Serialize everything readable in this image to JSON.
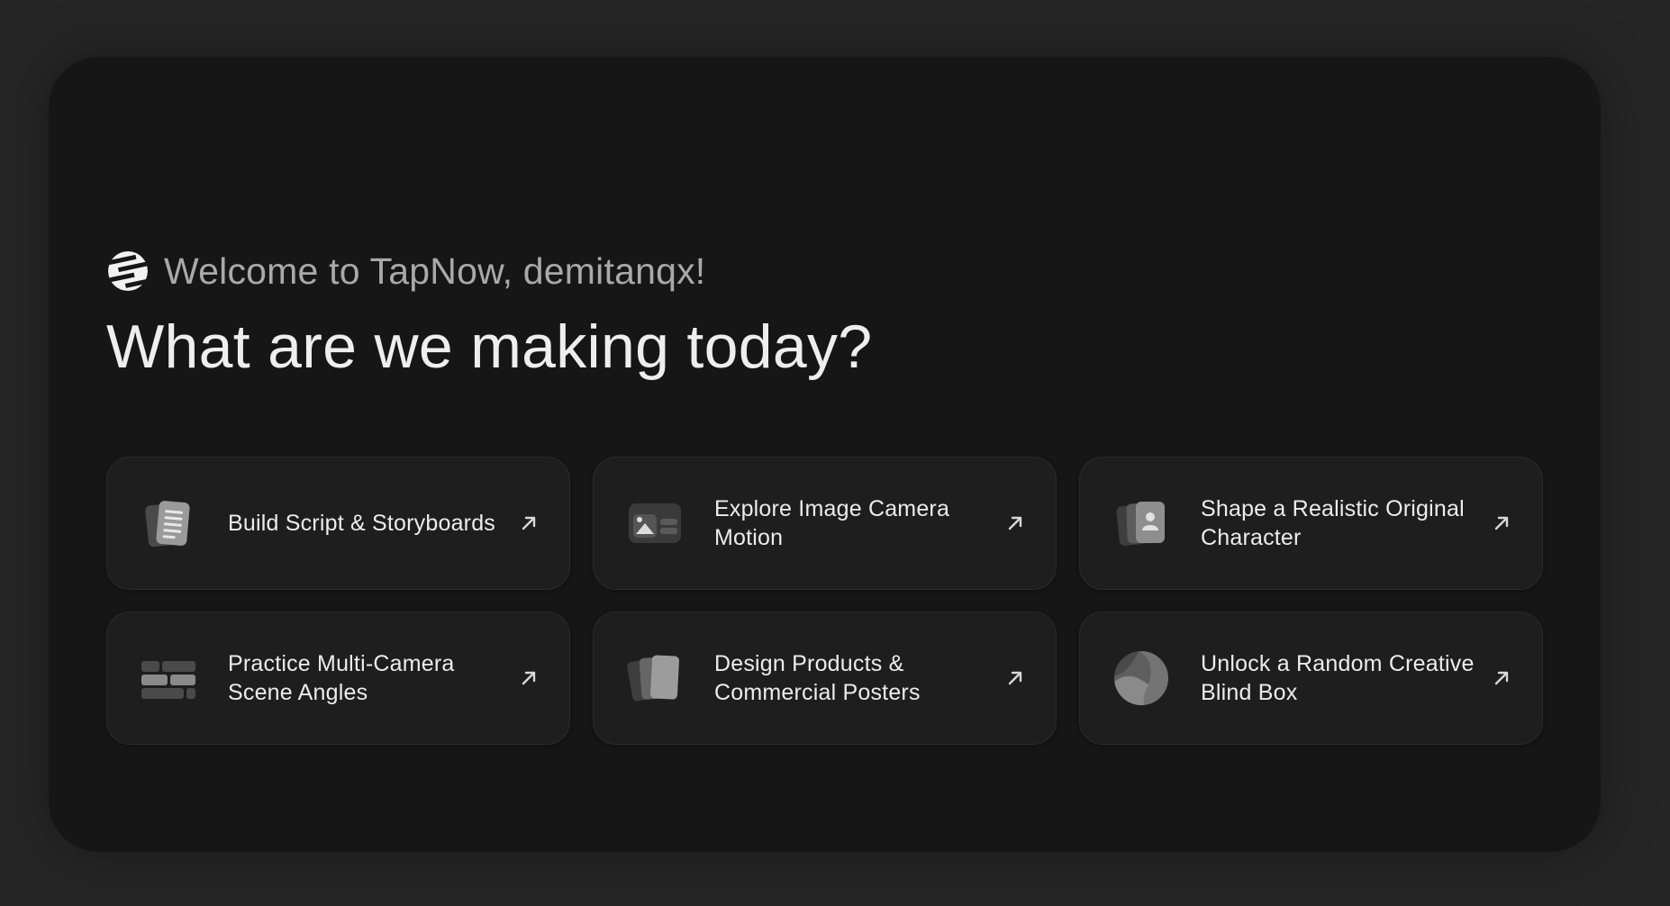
{
  "welcome": {
    "text": "Welcome to TapNow, demitanqx!"
  },
  "headline": "What are we making today?",
  "cards": [
    {
      "label": "Build Script & Storyboards",
      "icon": "script-storyboard-icon"
    },
    {
      "label": "Explore Image Camera Motion",
      "icon": "image-camera-icon"
    },
    {
      "label": "Shape a Realistic Original Character",
      "icon": "character-card-icon"
    },
    {
      "label": "Practice Multi-Camera Scene Angles",
      "icon": "multi-camera-grid-icon"
    },
    {
      "label": "Design Products & Commercial Posters",
      "icon": "poster-stack-icon"
    },
    {
      "label": "Unlock a Random Creative Blind Box",
      "icon": "blind-box-icon"
    }
  ],
  "colors": {
    "background": "#262626",
    "panel": "#161616",
    "card": "#1e1e1e",
    "text_primary": "#eeeeee",
    "text_secondary": "#a9a9a9"
  }
}
